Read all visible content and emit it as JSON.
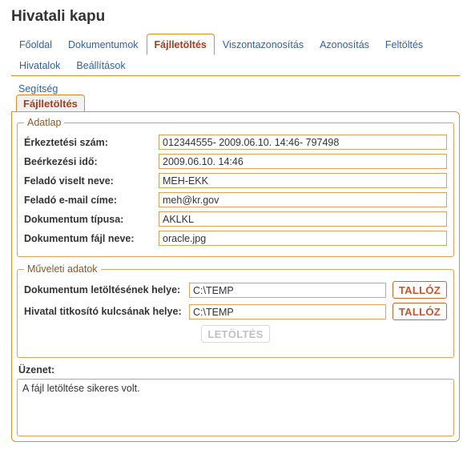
{
  "title": "Hivatali kapu",
  "tabs": {
    "items": [
      "Főoldal",
      "Dokumentumok",
      "Fájlletöltés",
      "Viszontazonosítás",
      "Azonosítás",
      "Feltöltés",
      "Hivatalok",
      "Beállítások"
    ],
    "help": "Segítség",
    "activeIndex": 2
  },
  "panelTitle": "Fájlletöltés",
  "adatlap": {
    "legend": "Adatlap",
    "fields": [
      {
        "label": "Érkeztetési szám:",
        "value": "012344555- 2009.06.10. 14:46- 797498"
      },
      {
        "label": "Beérkezési idő:",
        "value": "2009.06.10. 14:46"
      },
      {
        "label": "Feladó viselt neve:",
        "value": "MEH-EKK"
      },
      {
        "label": "Feladó e-mail címe:",
        "value": "meh@kr.gov"
      },
      {
        "label": "Dokumentum típusa:",
        "value": "AKLKL"
      },
      {
        "label": "Dokumentum fájl neve:",
        "value": "oracle.jpg"
      }
    ]
  },
  "muveleti": {
    "legend": "Műveleti adatok",
    "docPathLabel": "Dokumentum letöltésének helye:",
    "docPathValue": "C:\\TEMP",
    "keyPathLabel": "Hivatal titkosító kulcsának helye:",
    "keyPathValue": "C:\\TEMP",
    "browseLabel": "TALLÓZ",
    "downloadLabel": "LETÖLTÉS"
  },
  "message": {
    "label": "Üzenet:",
    "text": "A fájl letöltése sikeres volt."
  }
}
